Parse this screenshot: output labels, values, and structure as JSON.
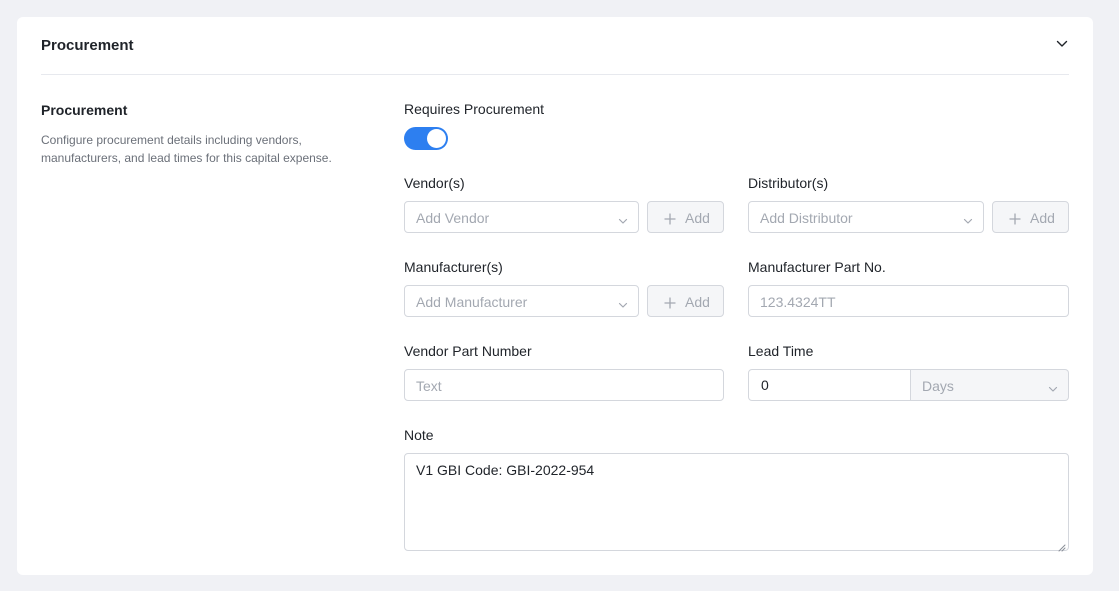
{
  "header": {
    "title": "Procurement"
  },
  "section": {
    "title": "Procurement",
    "description": "Configure procurement details including vendors, manufacturers, and lead times for this capital expense."
  },
  "requires_procurement": {
    "label": "Requires Procurement",
    "enabled": true
  },
  "vendors": {
    "label": "Vendor(s)",
    "placeholder": "Add Vendor",
    "add_label": "Add"
  },
  "distributors": {
    "label": "Distributor(s)",
    "placeholder": "Add Distributor",
    "add_label": "Add"
  },
  "manufacturers": {
    "label": "Manufacturer(s)",
    "placeholder": "Add Manufacturer",
    "add_label": "Add"
  },
  "manufacturer_part_no": {
    "label": "Manufacturer Part No.",
    "placeholder": "123.4324TT"
  },
  "vendor_part_number": {
    "label": "Vendor Part Number",
    "placeholder": "Text"
  },
  "lead_time": {
    "label": "Lead Time",
    "value": "0",
    "unit_placeholder": "Days"
  },
  "note": {
    "label": "Note",
    "value": "V1 GBI Code: GBI-2022-954"
  },
  "colors": {
    "accent": "#2d7ff0",
    "background": "#f0f1f5"
  }
}
